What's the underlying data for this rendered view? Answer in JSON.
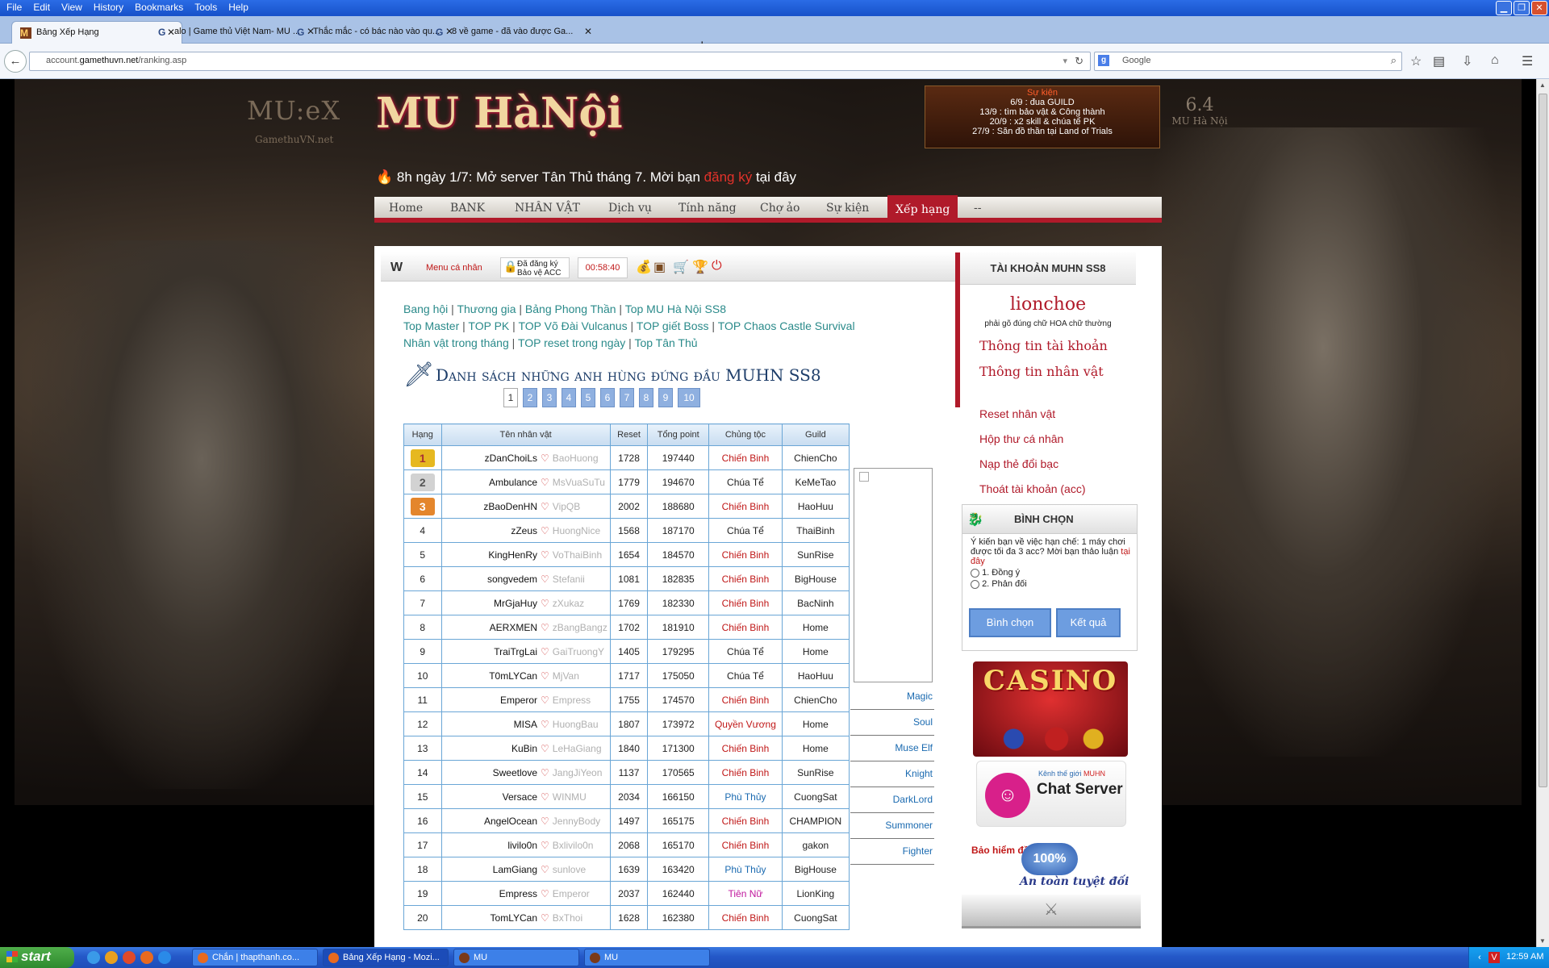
{
  "browser": {
    "menu": [
      "File",
      "Edit",
      "View",
      "History",
      "Bookmarks",
      "Tools",
      "Help"
    ],
    "tabs": [
      {
        "title": "Bảng Xếp Hạng",
        "active": true
      },
      {
        "title": "alo | Game thủ Việt Nam- MU ...",
        "active": false
      },
      {
        "title": "Thắc mắc - có bác nào vào qu...",
        "active": false
      },
      {
        "title": "8 về game - đã vào được Ga...",
        "active": false
      }
    ],
    "url_prefix": "account.",
    "url_domain": "gamethuvn.net",
    "url_path": "/ranking.asp",
    "search_placeholder": "Google"
  },
  "header": {
    "mu_logo": "MU:eX",
    "mu_logo_sub": "GamethuVN.net",
    "site_logo": "MU HàNội",
    "banner": {
      "title": "Sự kiện",
      "lines": [
        "6/9 : đua GUILD",
        "13/9 : tìm bảo vật & Công thành",
        "20/9 : x2 skill & chúa tể PK",
        "27/9 : Săn đồ thần tại Land of Trials"
      ]
    },
    "badge": {
      "version": "6.4",
      "name": "MU Hà Nội"
    },
    "marquee": {
      "pre": "8h ngày 1/7: Mở server Tân Thủ tháng 7. Mời bạn ",
      "link": "đăng ký",
      "post": " tại đây"
    }
  },
  "nav": [
    "Home",
    "BANK",
    "NHÂN VẬT",
    "Dịch vụ",
    "Tính năng",
    "Chợ ảo",
    "Sự kiện",
    "Xếp hạng",
    "--"
  ],
  "toolbar": {
    "menu": "Menu cá nhân",
    "registered": "Đã đăng ký",
    "protect": "Bảo vệ ACC",
    "time": "00:58:40"
  },
  "links": [
    [
      "Bang hội",
      "Thương gia",
      "Bảng Phong Thần",
      "Top MU Hà Nội SS8"
    ],
    [
      "Top Master",
      "TOP PK",
      "TOP Võ Đài Vulcanus",
      "TOP giết Boss",
      "TOP Chaos Castle Survival"
    ],
    [
      "Nhân vật trong tháng",
      "TOP reset trong ngày",
      "Top Tân Thủ"
    ]
  ],
  "title": "Danh sách những anh hùng đứng đầu MUHN SS8",
  "pages": [
    "1",
    "2",
    "3",
    "4",
    "5",
    "6",
    "7",
    "8",
    "9",
    "10"
  ],
  "table": {
    "headers": [
      "Hạng",
      "Tên nhân vật",
      "Reset",
      "Tổng point",
      "Chủng tộc",
      "Guild"
    ],
    "rows": [
      {
        "rank": "1",
        "name": "zDanChoiLs",
        "alt": "BaoHuong",
        "reset": "1728",
        "points": "197440",
        "cls": "Chiến Binh",
        "guild": "ChienCho"
      },
      {
        "rank": "2",
        "name": "Ambulance",
        "alt": "MsVuaSuTu",
        "reset": "1779",
        "points": "194670",
        "cls": "Chúa Tể",
        "guild": "KeMeTao"
      },
      {
        "rank": "3",
        "name": "zBaoDenHN",
        "alt": "VipQB",
        "reset": "2002",
        "points": "188680",
        "cls": "Chiến Binh",
        "guild": "HaoHuu"
      },
      {
        "rank": "4",
        "name": "zZeus",
        "alt": "HuongNice",
        "reset": "1568",
        "points": "187170",
        "cls": "Chúa Tể",
        "guild": "ThaiBinh"
      },
      {
        "rank": "5",
        "name": "KingHenRy",
        "alt": "VoThaiBinh",
        "reset": "1654",
        "points": "184570",
        "cls": "Chiến Binh",
        "guild": "SunRise"
      },
      {
        "rank": "6",
        "name": "songvedem",
        "alt": "Stefanii",
        "reset": "1081",
        "points": "182835",
        "cls": "Chiến Binh",
        "guild": "BigHouse"
      },
      {
        "rank": "7",
        "name": "MrGjaHuy",
        "alt": "zXukaz",
        "reset": "1769",
        "points": "182330",
        "cls": "Chiến Binh",
        "guild": "BacNinh"
      },
      {
        "rank": "8",
        "name": "AERXMEN",
        "alt": "zBangBangz",
        "reset": "1702",
        "points": "181910",
        "cls": "Chiến Binh",
        "guild": "Home"
      },
      {
        "rank": "9",
        "name": "TraiTrgLai",
        "alt": "GaiTruongY",
        "reset": "1405",
        "points": "179295",
        "cls": "Chúa Tể",
        "guild": "Home"
      },
      {
        "rank": "10",
        "name": "T0mLYCan",
        "alt": "MjVan",
        "reset": "1717",
        "points": "175050",
        "cls": "Chúa Tể",
        "guild": "HaoHuu"
      },
      {
        "rank": "11",
        "name": "Emperor",
        "alt": "Empress",
        "reset": "1755",
        "points": "174570",
        "cls": "Chiến Binh",
        "guild": "ChienCho"
      },
      {
        "rank": "12",
        "name": "MISA",
        "alt": "HuongBau",
        "reset": "1807",
        "points": "173972",
        "cls": "Quyền Vương",
        "guild": "Home"
      },
      {
        "rank": "13",
        "name": "KuBin",
        "alt": "LeHaGiang",
        "reset": "1840",
        "points": "171300",
        "cls": "Chiến Binh",
        "guild": "Home"
      },
      {
        "rank": "14",
        "name": "Sweetlove",
        "alt": "JangJiYeon",
        "reset": "1137",
        "points": "170565",
        "cls": "Chiến Binh",
        "guild": "SunRise"
      },
      {
        "rank": "15",
        "name": "Versace",
        "alt": "WINMU",
        "reset": "2034",
        "points": "166150",
        "cls": "Phù Thủy",
        "guild": "CuongSat"
      },
      {
        "rank": "16",
        "name": "AngelOcean",
        "alt": "JennyBody",
        "reset": "1497",
        "points": "165175",
        "cls": "Chiến Binh",
        "guild": "CHAMPION"
      },
      {
        "rank": "17",
        "name": "livilo0n",
        "alt": "Bxlivilo0n",
        "reset": "2068",
        "points": "165170",
        "cls": "Chiến Binh",
        "guild": "gakon"
      },
      {
        "rank": "18",
        "name": "LamGiang",
        "alt": "sunlove",
        "reset": "1639",
        "points": "163420",
        "cls": "Phù Thủy",
        "guild": "BigHouse"
      },
      {
        "rank": "19",
        "name": "Empress",
        "alt": "Emperor",
        "reset": "2037",
        "points": "162440",
        "cls": "Tiên Nữ",
        "guild": "LionKing"
      },
      {
        "rank": "20",
        "name": "TomLYCan",
        "alt": "BxThoi",
        "reset": "1628",
        "points": "162380",
        "cls": "Chiến Binh",
        "guild": "CuongSat"
      }
    ]
  },
  "classes": [
    "Magic",
    "Soul",
    "Muse Elf",
    "Knight",
    "DarkLord",
    "Summoner",
    "Fighter"
  ],
  "account": {
    "title": "TÀI KHOẢN MUHN SS8",
    "username": "lionchoe",
    "note": "phải gõ đúng chữ HOA chữ thường",
    "links_bold": [
      "Thông tin tài khoản",
      "Thông tin nhân vật"
    ],
    "links": [
      "Reset nhân vật",
      "Hộp thư cá nhân",
      "Nạp thẻ đổi bạc",
      "Thoát tài khoản (acc)"
    ]
  },
  "poll": {
    "title": "BÌNH CHỌN",
    "question": "Ý kiến bạn về việc hạn chế: 1 máy chơi được tối đa 3 acc? Mời bạn thảo luận ",
    "question_link": "tại đây",
    "options": [
      "1. Đồng ý",
      "2. Phản đối"
    ],
    "vote": "Bình chọn",
    "result": "Kết quả"
  },
  "ads": {
    "casino": "CASINO",
    "chat_channel": "Kênh thế giới ",
    "chat_brand": "MUHN",
    "chat_title": "Chat Server",
    "insurance": "Bảo hiểm đồ",
    "insurance_pct": "100%",
    "insurance_tag": "An toàn tuyệt đối"
  },
  "taskbar": {
    "start": "start",
    "items": [
      {
        "label": "Chắn | thapthanh.co...",
        "active": false
      },
      {
        "label": "Bảng Xếp Hạng - Mozi...",
        "active": true
      },
      {
        "label": "MU",
        "active": false
      },
      {
        "label": "MU",
        "active": false
      }
    ],
    "clock": "12:59 AM"
  },
  "colors": {
    "accent": "#b01a2a",
    "link": "#2a8a8a",
    "warrior": "#c01818",
    "mage": "#1a6ab0",
    "fairy": "#c0169c"
  }
}
